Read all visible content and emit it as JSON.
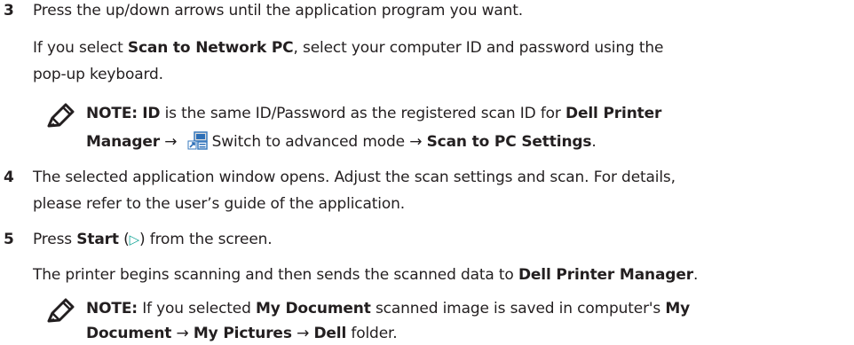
{
  "steps": {
    "step3": {
      "number": "3",
      "text": "Press the up/down arrows until the application program you want.",
      "para_pre": "If you select ",
      "para_bold": "Scan to Network PC",
      "para_post1": ", select your computer ID and password using the",
      "para_post2": "pop-up keyboard.",
      "note": {
        "label": "NOTE:",
        "bold_id": "ID",
        "text1": " is the same ID/Password as the registered scan ID for ",
        "bold_app1": "Dell Printer",
        "bold_app2": "Manager",
        "arrow1": "→",
        "mid": "Switch to advanced mode",
        "arrow2": "→",
        "bold_settings": "Scan to PC Settings",
        "end": "."
      }
    },
    "step4": {
      "number": "4",
      "line1": "The selected application window opens. Adjust the scan settings and scan. For details,",
      "line2": "please refer to the user’s guide of the application."
    },
    "step5": {
      "number": "5",
      "pre": "Press ",
      "bold_start": "Start",
      "paren_open": " (",
      "play_glyph": "▷",
      "paren_close": ")",
      "post": " from the screen.",
      "para_pre": "The printer begins scanning and then sends the scanned data to ",
      "para_bold": "Dell Printer Manager",
      "para_post": ".",
      "note": {
        "label": "NOTE:",
        "text1": " If you selected ",
        "bold_mydoc": "My Document",
        "text2": " scanned image is saved in computer's ",
        "bold_my": "My",
        "bold_document": "Document",
        "arrow1": "→",
        "bold_pictures": "My Pictures",
        "arrow2": "→",
        "bold_dell": "Dell",
        "end": " folder."
      }
    }
  },
  "icons": {
    "note_icon": "pencil-note-icon",
    "app_icon": "switch-advanced-mode-icon",
    "play_icon": "start-play-icon",
    "accent_color": "#1aa79a"
  }
}
